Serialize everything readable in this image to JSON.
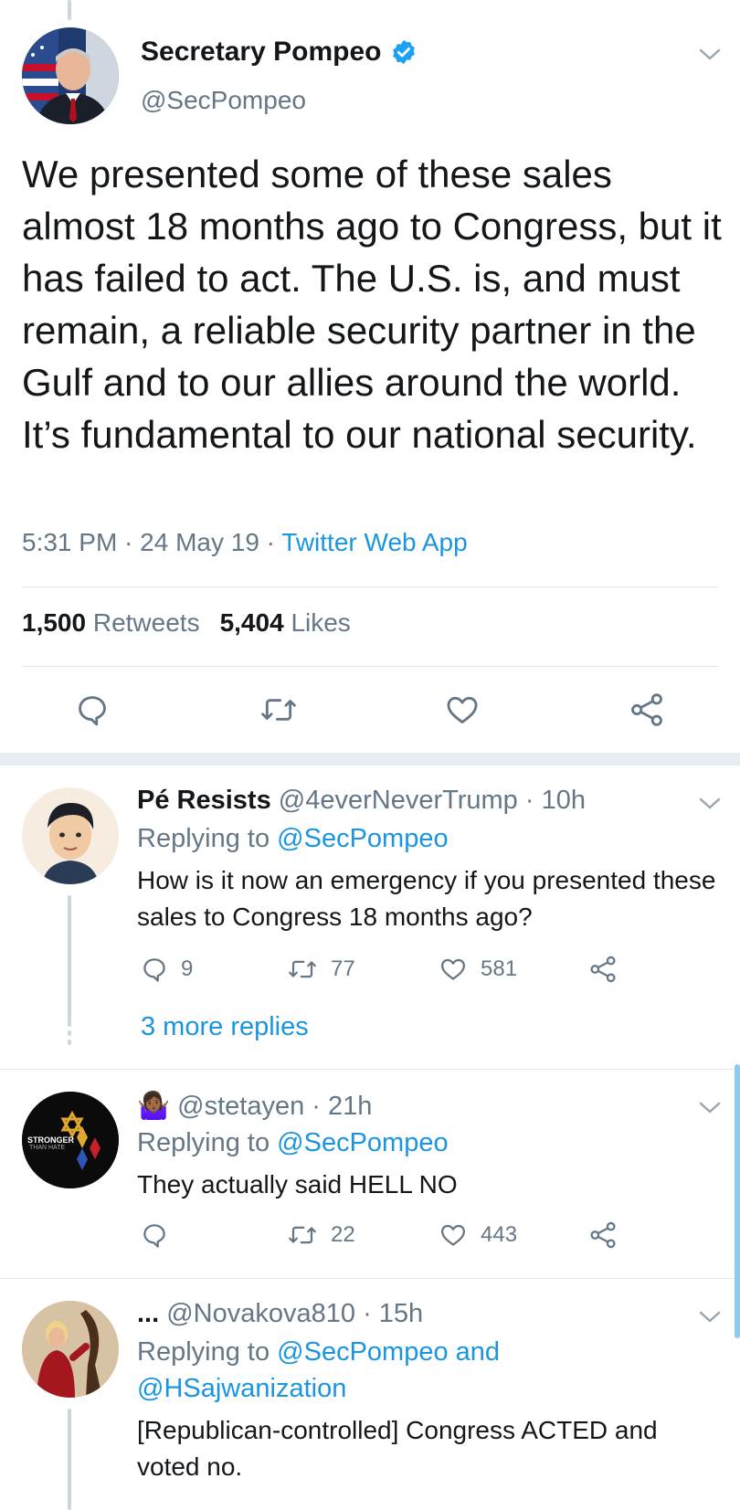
{
  "main_tweet": {
    "display_name": "Secretary Pompeo",
    "handle": "@SecPompeo",
    "text": "We presented some of these sales almost 18 months ago to Congress, but it has failed to act. The U.S. is, and must remain, a reliable security partner in the Gulf and to our allies around the world. It’s fundamental to our national security.",
    "time": "5:31 PM · 24 May 19 · ",
    "source": "Twitter Web App",
    "retweets_count": "1,500",
    "retweets_label": "Retweets",
    "likes_count": "5,404",
    "likes_label": "Likes"
  },
  "replies": [
    {
      "display_name": "Pé Resists",
      "handle_time": "@4everNeverTrump · 10h",
      "replying_prefix": "Replying to ",
      "replying_to": "@SecPompeo",
      "text": "How is it now an emergency if you presented these sales to Congress 18 months ago?",
      "reply_count": "9",
      "retweet_count": "77",
      "like_count": "581",
      "more_replies": "3 more replies"
    },
    {
      "display_name": "🤷🏾‍♀️",
      "handle_time": "@stetayen · 21h",
      "replying_prefix": "Replying to ",
      "replying_to": "@SecPompeo",
      "text": "They actually said HELL NO",
      "reply_count": "",
      "retweet_count": "22",
      "like_count": "443",
      "avatar_text_1": "STRONGER",
      "avatar_text_2": "THAN HATE"
    },
    {
      "display_name": "...",
      "handle_time": "@Novakova810 · 15h",
      "replying_prefix": "Replying to ",
      "replying_to": "@SecPompeo and",
      "replying_to_2": "@HSajwanization",
      "text": "[Republican-controlled] Congress ACTED and voted no."
    }
  ],
  "colors": {
    "accent": "#1b95e0",
    "muted": "#657786",
    "text": "#14171a",
    "divider": "#e1e8ed",
    "verified": "#1da1f2"
  }
}
